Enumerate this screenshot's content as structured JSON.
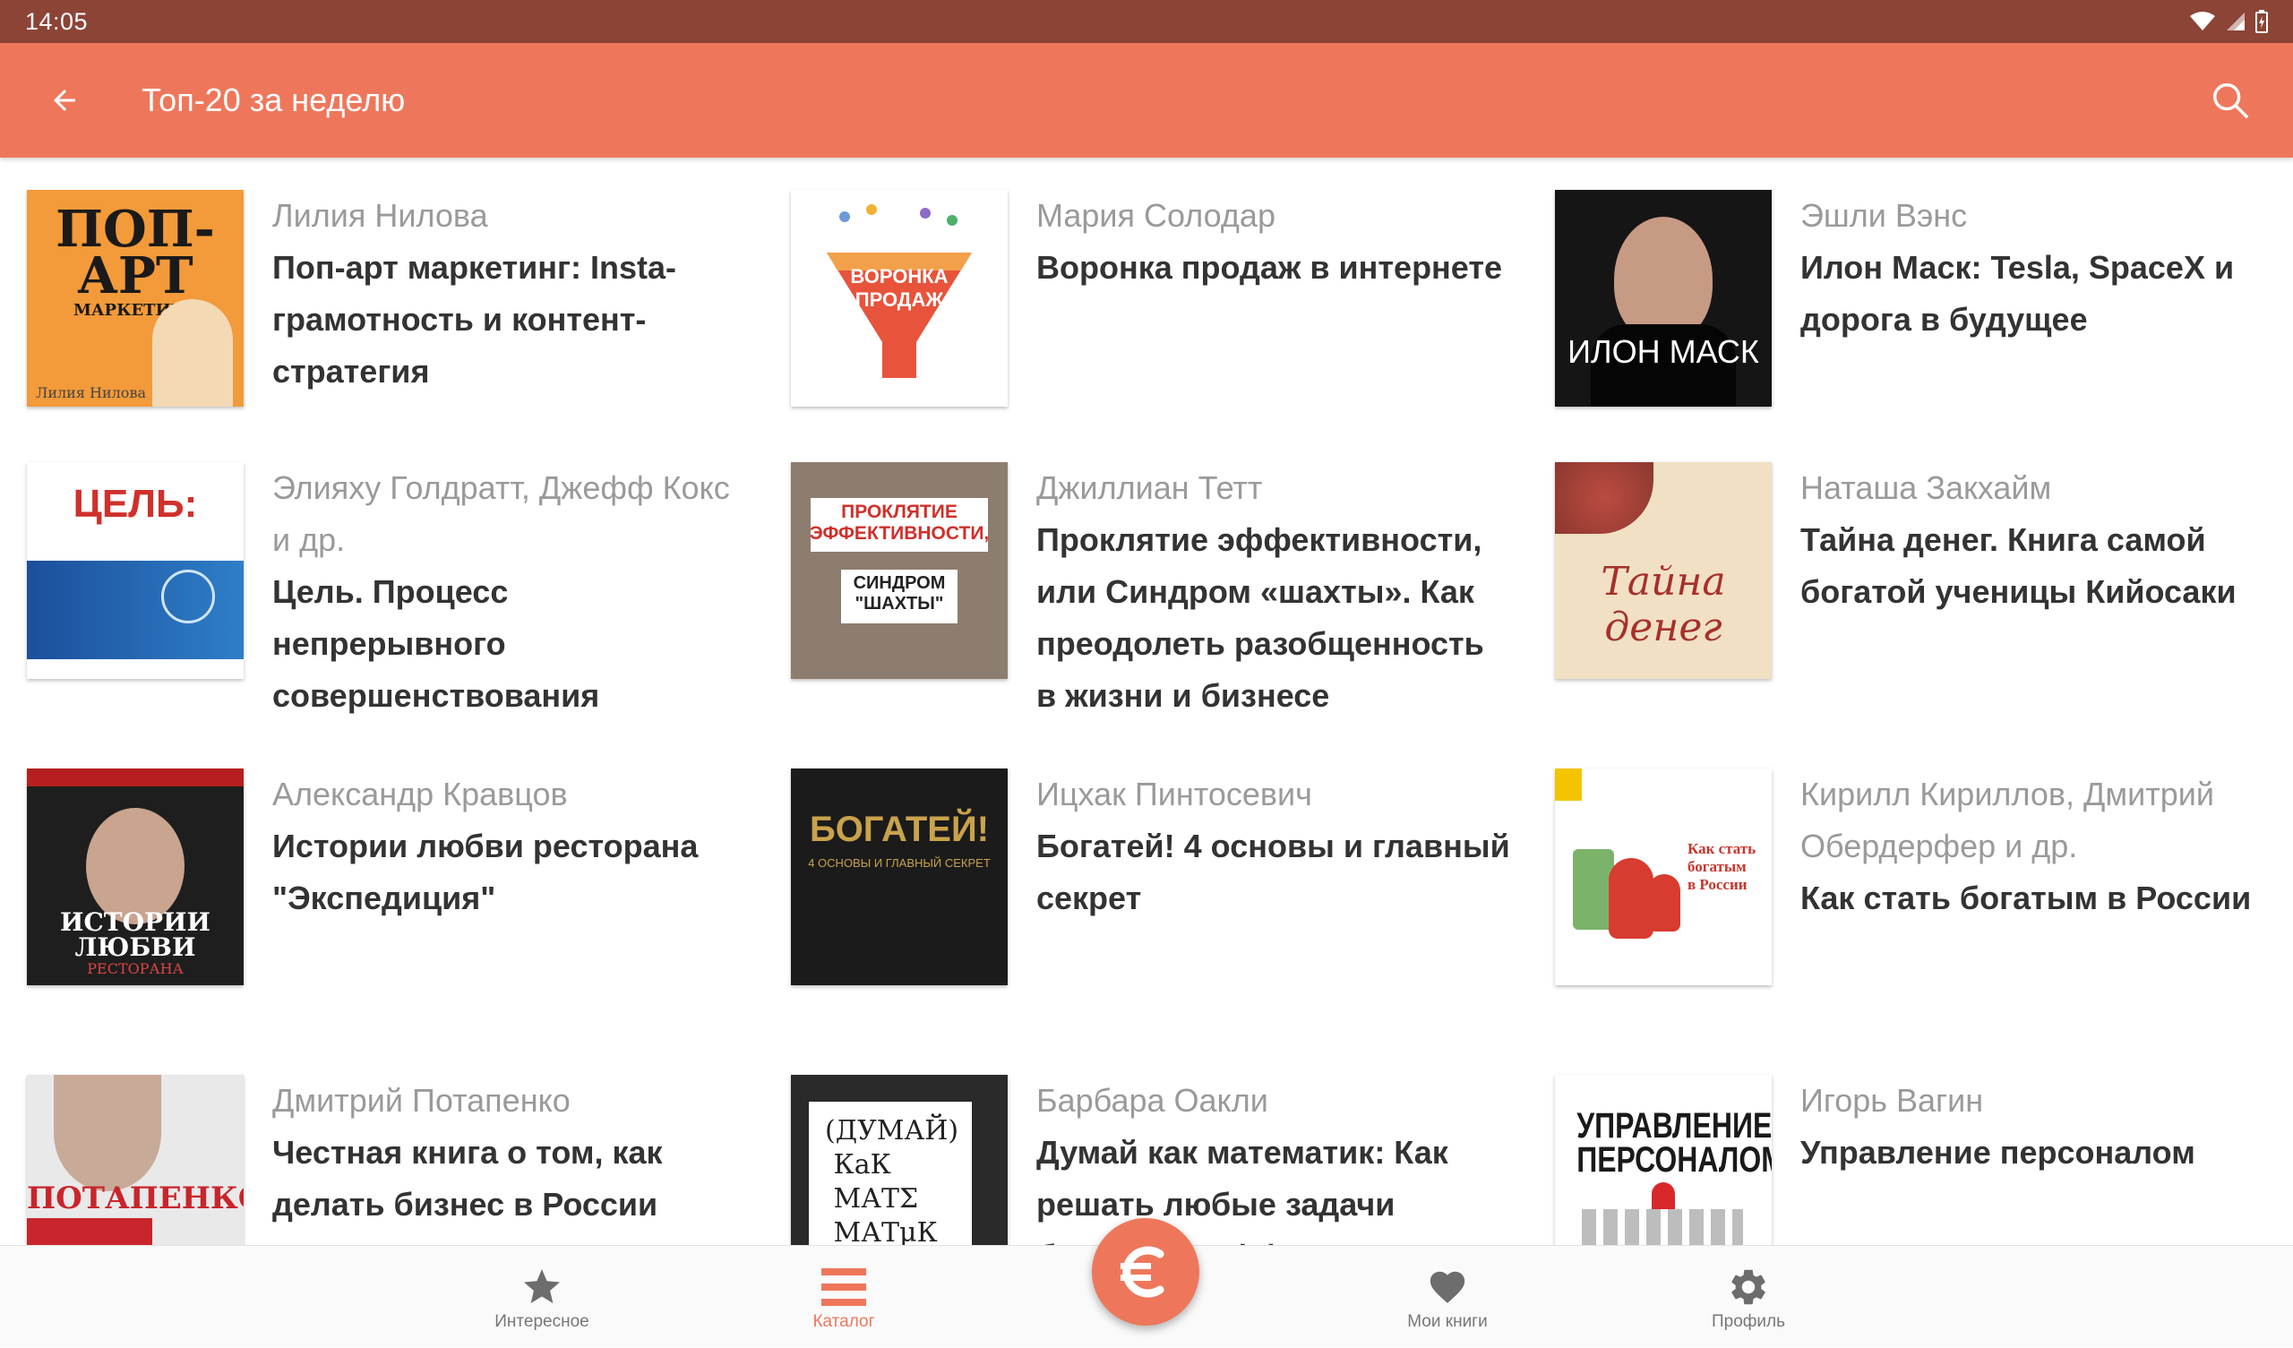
{
  "status_bar": {
    "time": "14:05"
  },
  "app_bar": {
    "title": "Топ-20 за неделю"
  },
  "colors": {
    "accent": "#ee775b",
    "status": "#8c4436",
    "author": "#9a9a9a",
    "title": "#333333"
  },
  "books": [
    {
      "author": "Лилия Нилова",
      "title": "Поп-арт маркетинг: Insta-грамотность и контент-стратегия",
      "cover_text": "ПОП-АРТ"
    },
    {
      "author": "Мария Солодар",
      "title": "Воронка продаж в интернете",
      "cover_text": "ВОРОНКА ПРОДАЖ"
    },
    {
      "author": "Эшли Вэнс",
      "title": "Илон Маск: Tesla, SpaceX и дорога в будущее",
      "cover_text": "ИЛОН МАСК"
    },
    {
      "author": "Элияху Голдратт, Джефф Кокс и др.",
      "title": "Цель. Процесс непрерывного совершенствования",
      "cover_text": "ЦЕЛЬ:"
    },
    {
      "author": "Джиллиан Тетт",
      "title": "Проклятие эффективности, или Синдром «шахты». Как преодолеть разобщенность в жизни и бизнесе",
      "cover_text": "ПРОКЛЯТИЕ ЭФФЕКТИВНОСТИ"
    },
    {
      "author": "Наташа Закхайм",
      "title": "Тайна денег. Книга самой богатой ученицы Кийосаки",
      "cover_text": "Тайна денег"
    },
    {
      "author": "Александр Кравцов",
      "title": "Истории любви ресторана \"Экспедиция\"",
      "cover_text": "ИСТОРИИ ЛЮБВИ"
    },
    {
      "author": "Ицхак Пинтосевич",
      "title": "Богатей! 4 основы и главный секрет",
      "cover_text": "БОГАТЕЙ!"
    },
    {
      "author": "Кирилл Кириллов, Дмитрий Обердерфер и др.",
      "title": "Как стать богатым в России",
      "cover_text": "Как стать богатым в России"
    },
    {
      "author": "Дмитрий Потапенко",
      "title": "Честная книга о том, как делать бизнес в России",
      "cover_text": "ПОТАПЕНКО"
    },
    {
      "author": "Барбара Оакли",
      "title": "Думай как математик: Как решать любые задачи быстрее и эффективнее",
      "cover_text": "(ДУМАЙ) КаК МАТЕ МАТµК"
    },
    {
      "author": "Игорь Вагин",
      "title": "Управление персоналом",
      "cover_text": "УПРАВЛЕНИЕ ПЕРСОНАЛОМ"
    }
  ],
  "bottom_nav": {
    "interesting": "Интересное",
    "catalog": "Каталог",
    "my_books": "Мои книги",
    "profile": "Профиль"
  }
}
